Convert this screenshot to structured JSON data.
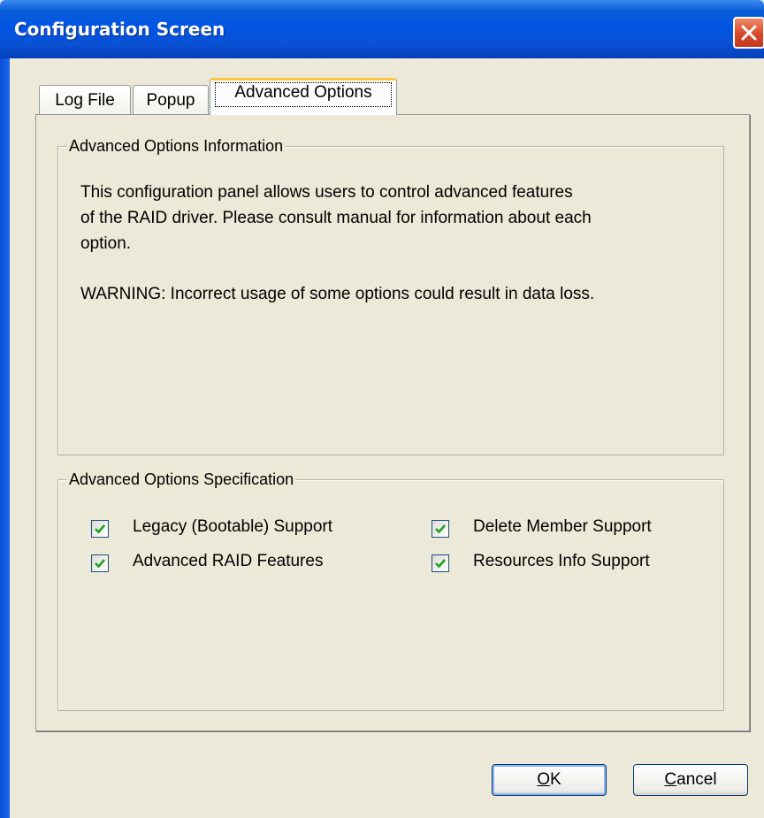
{
  "window": {
    "title": "Configuration Screen"
  },
  "tabs": [
    {
      "label": "Log File"
    },
    {
      "label": "Popup"
    },
    {
      "label": "Advanced Options"
    }
  ],
  "info_group": {
    "label": "Advanced Options Information",
    "lines": [
      "This configuration panel allows users to control advanced features",
      "of the RAID driver. Please consult manual for information about each",
      "option.",
      "WARNING: Incorrect usage of some options could result in data loss."
    ]
  },
  "spec_group": {
    "label": "Advanced Options Specification",
    "options": [
      {
        "label": "Legacy (Bootable) Support",
        "checked": true
      },
      {
        "label": "Delete Member Support",
        "checked": true
      },
      {
        "label": "Advanced RAID Features",
        "checked": true
      },
      {
        "label": "Resources Info Support",
        "checked": true
      }
    ]
  },
  "buttons": {
    "ok": {
      "mnemonic": "O",
      "rest": "K"
    },
    "cancel": {
      "mnemonic": "C",
      "rest": "ancel"
    }
  },
  "colors": {
    "title_bar": "#0054e3",
    "tab_highlight": "#ffc83c",
    "check_mark": "#21a121",
    "close_button": "#d6482a"
  }
}
